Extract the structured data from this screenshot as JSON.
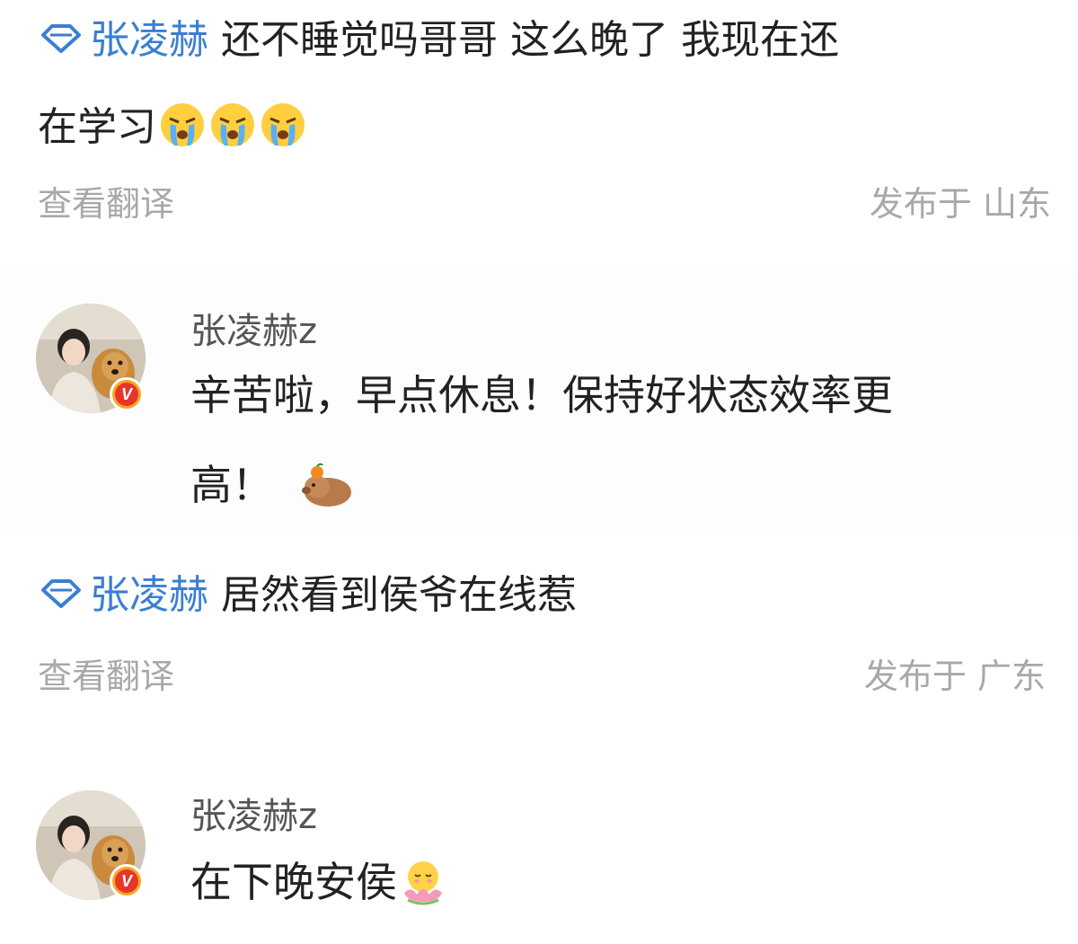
{
  "comments": [
    {
      "author": "张凌赫",
      "text_line1": "还不睡觉吗哥哥 这么晚了 我现在还",
      "text_line2": "在学习",
      "translate_label": "查看翻译",
      "location": "发布于 山东",
      "reply": {
        "name": "张凌赫z",
        "text_line1": "辛苦啦，早点休息！保持好状态效率更",
        "text_line2": "高！"
      }
    },
    {
      "author": "张凌赫",
      "text_line1": "居然看到侯爷在线惹",
      "translate_label": "查看翻译",
      "location": "发布于 广东",
      "reply": {
        "name": "张凌赫z",
        "text_line1": "在下晚安侯"
      }
    }
  ],
  "badge_letter": "V",
  "icons": {
    "author_badge": "diamond-icon",
    "crying": "crying-emoji",
    "capybara": "capybara-emoji",
    "lotus": "lotus-emoji"
  },
  "colors": {
    "author_link": "#3a7fd1",
    "meta": "#a8a8a8",
    "verified_outer": "#f5a623",
    "verified_inner": "#e8352c"
  }
}
